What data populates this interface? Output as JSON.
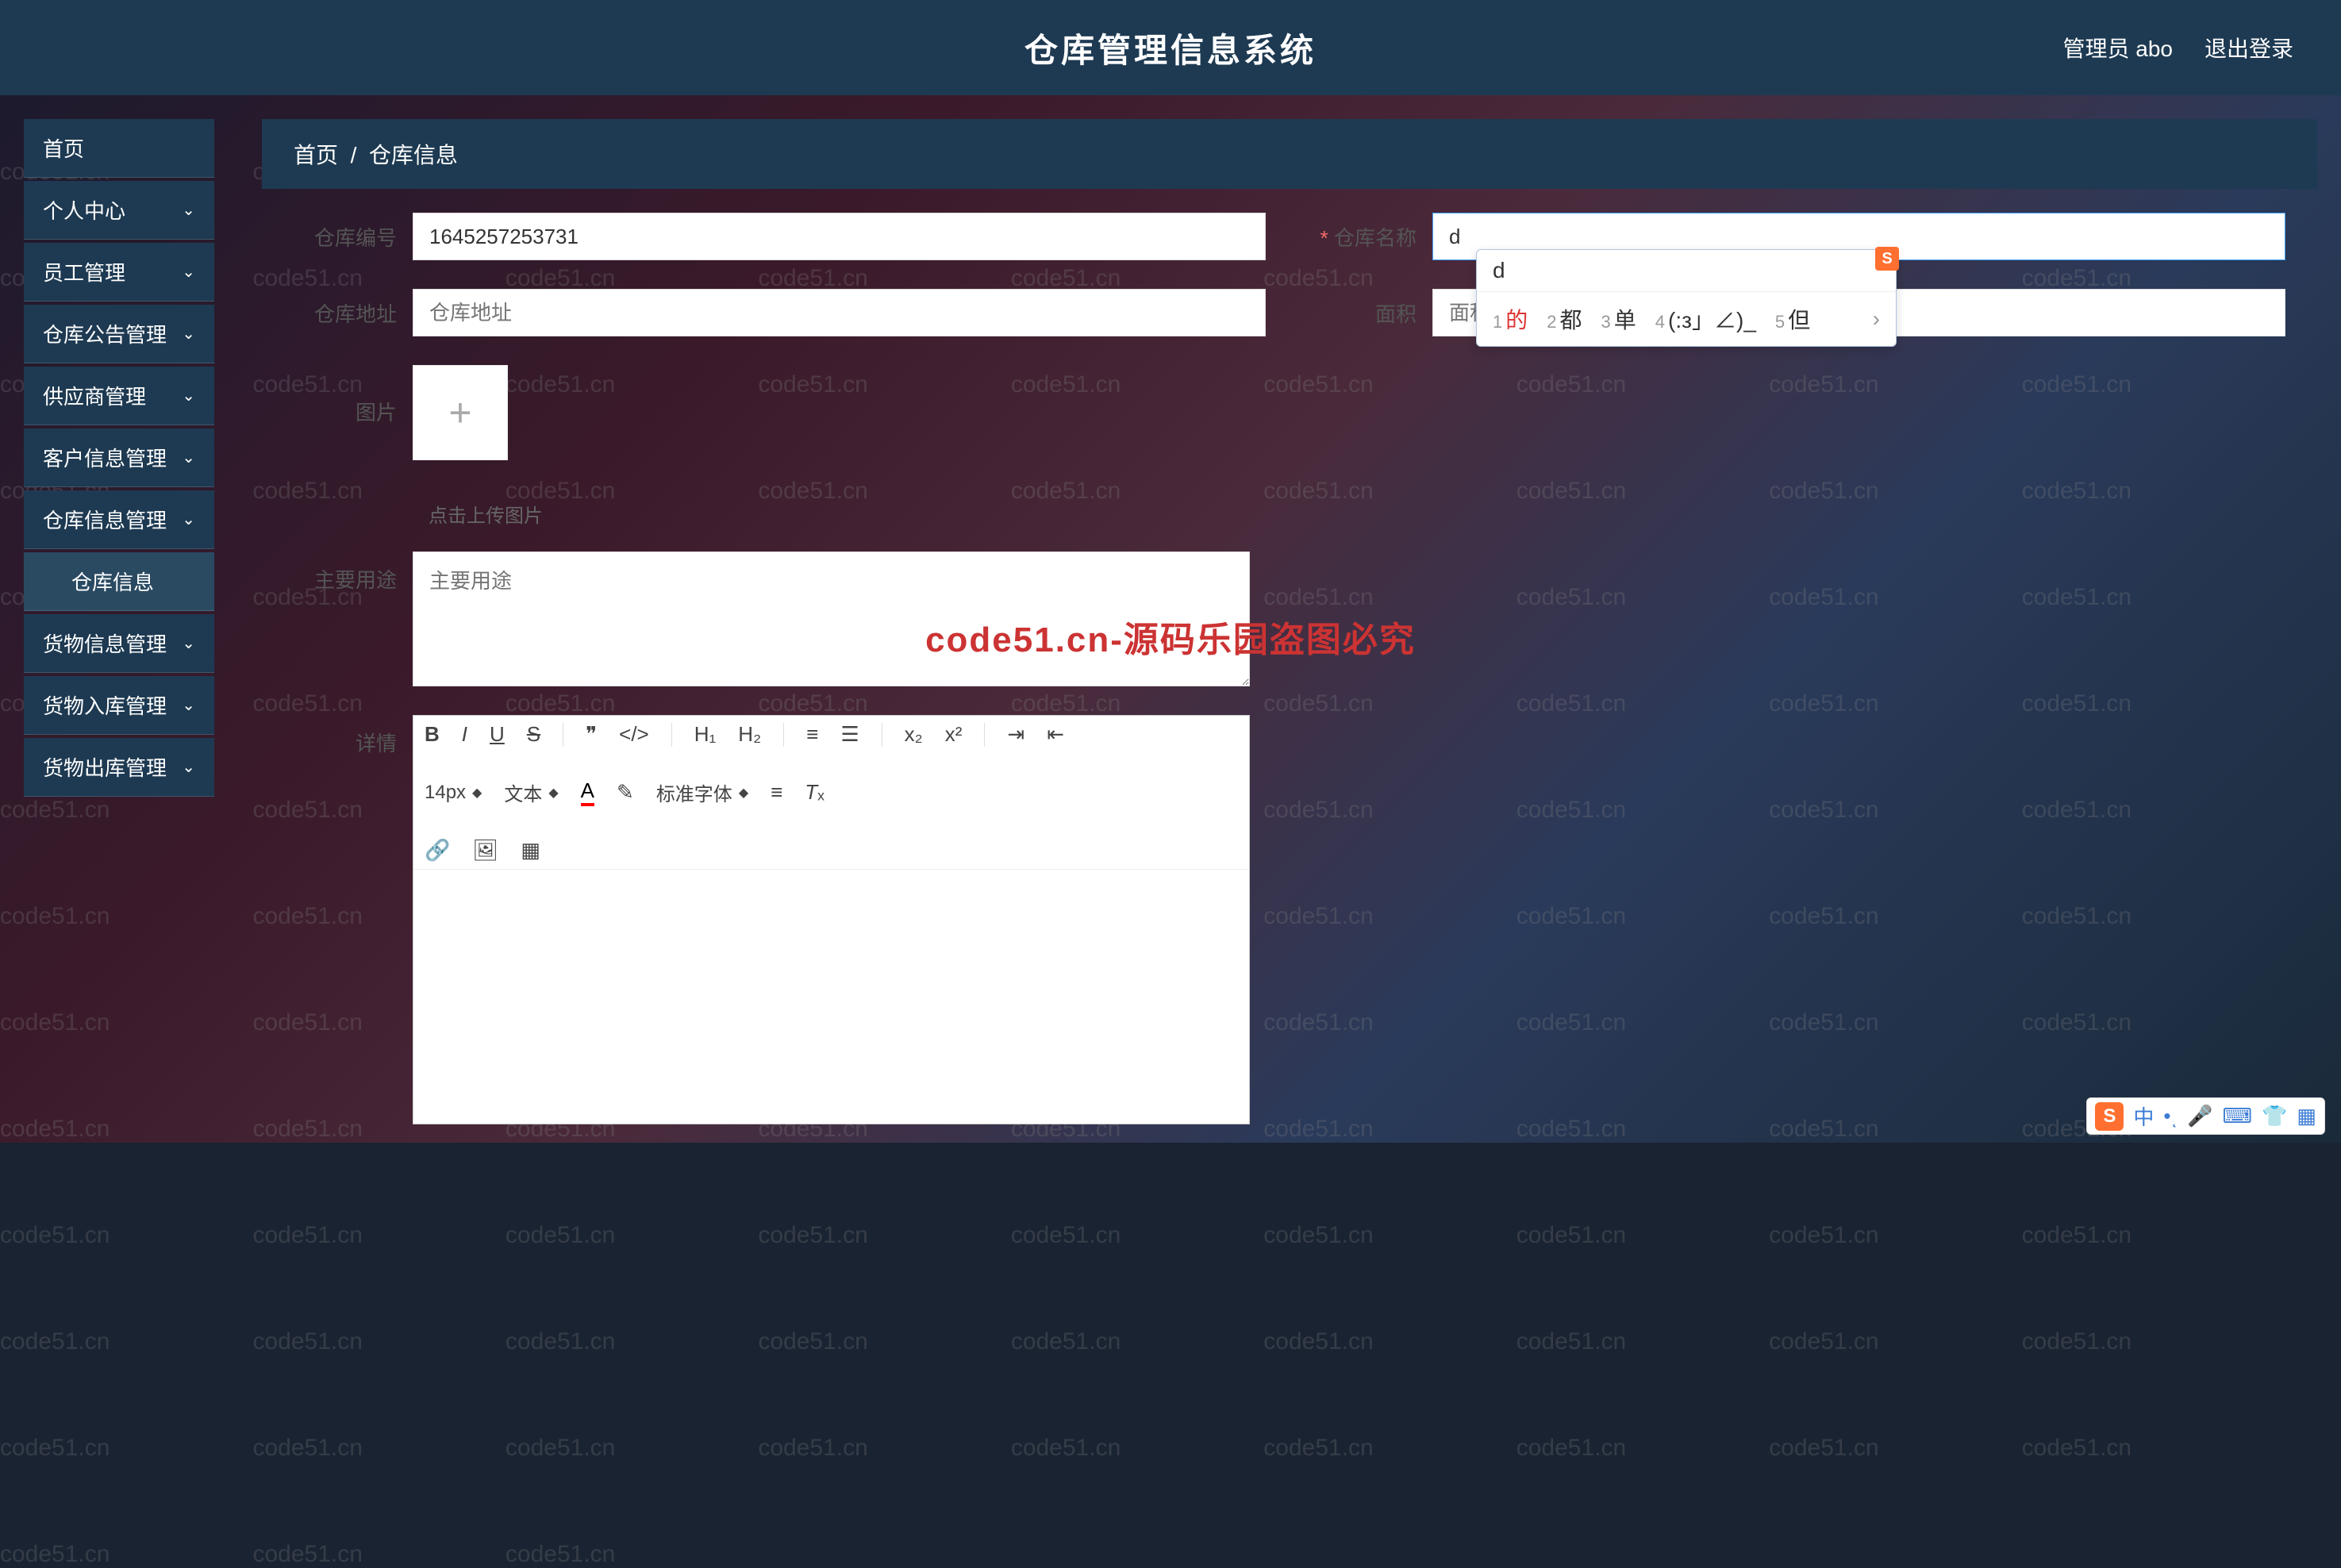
{
  "header": {
    "title": "仓库管理信息系统",
    "admin_label": "管理员 abo",
    "logout_label": "退出登录"
  },
  "sidebar": {
    "items": [
      {
        "label": "首页",
        "has_children": false
      },
      {
        "label": "个人中心",
        "has_children": true
      },
      {
        "label": "员工管理",
        "has_children": true
      },
      {
        "label": "仓库公告管理",
        "has_children": true
      },
      {
        "label": "供应商管理",
        "has_children": true
      },
      {
        "label": "客户信息管理",
        "has_children": true
      },
      {
        "label": "仓库信息管理",
        "has_children": true,
        "expanded": true,
        "children": [
          {
            "label": "仓库信息"
          }
        ]
      },
      {
        "label": "货物信息管理",
        "has_children": true
      },
      {
        "label": "货物入库管理",
        "has_children": true
      },
      {
        "label": "货物出库管理",
        "has_children": true
      }
    ]
  },
  "breadcrumb": {
    "home": "首页",
    "sep": "/",
    "current": "仓库信息"
  },
  "form": {
    "warehouse_id_label": "仓库编号",
    "warehouse_id_value": "1645257253731",
    "warehouse_name_label": "仓库名称",
    "warehouse_name_value": "d",
    "warehouse_addr_label": "仓库地址",
    "warehouse_addr_placeholder": "仓库地址",
    "area_label": "面积",
    "area_placeholder": "面积",
    "image_label": "图片",
    "upload_hint": "点击上传图片",
    "main_use_label": "主要用途",
    "main_use_placeholder": "主要用途",
    "detail_label": "详情"
  },
  "editor_toolbar": {
    "font_size": "14px",
    "text_type": "文本",
    "font_family": "标准字体"
  },
  "ime": {
    "input": "d",
    "candidates": [
      {
        "num": "1",
        "text": "的",
        "active": true
      },
      {
        "num": "2",
        "text": "都"
      },
      {
        "num": "3",
        "text": "单"
      },
      {
        "num": "4",
        "text": "(:з」∠)_"
      },
      {
        "num": "5",
        "text": "但"
      }
    ]
  },
  "center_mark": "code51.cn-源码乐园盗图必究",
  "watermark": "code51.cn"
}
